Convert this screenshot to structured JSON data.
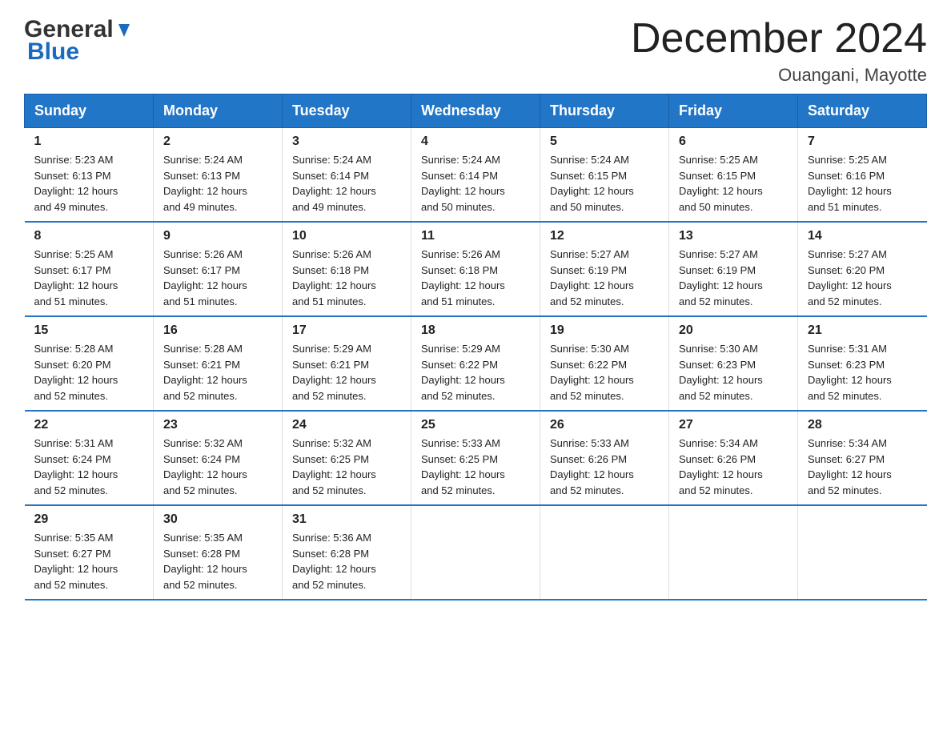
{
  "header": {
    "logo_general": "General",
    "logo_blue": "Blue",
    "month_title": "December 2024",
    "location": "Ouangani, Mayotte"
  },
  "days_of_week": [
    "Sunday",
    "Monday",
    "Tuesday",
    "Wednesday",
    "Thursday",
    "Friday",
    "Saturday"
  ],
  "weeks": [
    [
      {
        "day": "1",
        "sunrise": "5:23 AM",
        "sunset": "6:13 PM",
        "daylight": "12 hours and 49 minutes."
      },
      {
        "day": "2",
        "sunrise": "5:24 AM",
        "sunset": "6:13 PM",
        "daylight": "12 hours and 49 minutes."
      },
      {
        "day": "3",
        "sunrise": "5:24 AM",
        "sunset": "6:14 PM",
        "daylight": "12 hours and 49 minutes."
      },
      {
        "day": "4",
        "sunrise": "5:24 AM",
        "sunset": "6:14 PM",
        "daylight": "12 hours and 50 minutes."
      },
      {
        "day": "5",
        "sunrise": "5:24 AM",
        "sunset": "6:15 PM",
        "daylight": "12 hours and 50 minutes."
      },
      {
        "day": "6",
        "sunrise": "5:25 AM",
        "sunset": "6:15 PM",
        "daylight": "12 hours and 50 minutes."
      },
      {
        "day": "7",
        "sunrise": "5:25 AM",
        "sunset": "6:16 PM",
        "daylight": "12 hours and 51 minutes."
      }
    ],
    [
      {
        "day": "8",
        "sunrise": "5:25 AM",
        "sunset": "6:17 PM",
        "daylight": "12 hours and 51 minutes."
      },
      {
        "day": "9",
        "sunrise": "5:26 AM",
        "sunset": "6:17 PM",
        "daylight": "12 hours and 51 minutes."
      },
      {
        "day": "10",
        "sunrise": "5:26 AM",
        "sunset": "6:18 PM",
        "daylight": "12 hours and 51 minutes."
      },
      {
        "day": "11",
        "sunrise": "5:26 AM",
        "sunset": "6:18 PM",
        "daylight": "12 hours and 51 minutes."
      },
      {
        "day": "12",
        "sunrise": "5:27 AM",
        "sunset": "6:19 PM",
        "daylight": "12 hours and 52 minutes."
      },
      {
        "day": "13",
        "sunrise": "5:27 AM",
        "sunset": "6:19 PM",
        "daylight": "12 hours and 52 minutes."
      },
      {
        "day": "14",
        "sunrise": "5:27 AM",
        "sunset": "6:20 PM",
        "daylight": "12 hours and 52 minutes."
      }
    ],
    [
      {
        "day": "15",
        "sunrise": "5:28 AM",
        "sunset": "6:20 PM",
        "daylight": "12 hours and 52 minutes."
      },
      {
        "day": "16",
        "sunrise": "5:28 AM",
        "sunset": "6:21 PM",
        "daylight": "12 hours and 52 minutes."
      },
      {
        "day": "17",
        "sunrise": "5:29 AM",
        "sunset": "6:21 PM",
        "daylight": "12 hours and 52 minutes."
      },
      {
        "day": "18",
        "sunrise": "5:29 AM",
        "sunset": "6:22 PM",
        "daylight": "12 hours and 52 minutes."
      },
      {
        "day": "19",
        "sunrise": "5:30 AM",
        "sunset": "6:22 PM",
        "daylight": "12 hours and 52 minutes."
      },
      {
        "day": "20",
        "sunrise": "5:30 AM",
        "sunset": "6:23 PM",
        "daylight": "12 hours and 52 minutes."
      },
      {
        "day": "21",
        "sunrise": "5:31 AM",
        "sunset": "6:23 PM",
        "daylight": "12 hours and 52 minutes."
      }
    ],
    [
      {
        "day": "22",
        "sunrise": "5:31 AM",
        "sunset": "6:24 PM",
        "daylight": "12 hours and 52 minutes."
      },
      {
        "day": "23",
        "sunrise": "5:32 AM",
        "sunset": "6:24 PM",
        "daylight": "12 hours and 52 minutes."
      },
      {
        "day": "24",
        "sunrise": "5:32 AM",
        "sunset": "6:25 PM",
        "daylight": "12 hours and 52 minutes."
      },
      {
        "day": "25",
        "sunrise": "5:33 AM",
        "sunset": "6:25 PM",
        "daylight": "12 hours and 52 minutes."
      },
      {
        "day": "26",
        "sunrise": "5:33 AM",
        "sunset": "6:26 PM",
        "daylight": "12 hours and 52 minutes."
      },
      {
        "day": "27",
        "sunrise": "5:34 AM",
        "sunset": "6:26 PM",
        "daylight": "12 hours and 52 minutes."
      },
      {
        "day": "28",
        "sunrise": "5:34 AM",
        "sunset": "6:27 PM",
        "daylight": "12 hours and 52 minutes."
      }
    ],
    [
      {
        "day": "29",
        "sunrise": "5:35 AM",
        "sunset": "6:27 PM",
        "daylight": "12 hours and 52 minutes."
      },
      {
        "day": "30",
        "sunrise": "5:35 AM",
        "sunset": "6:28 PM",
        "daylight": "12 hours and 52 minutes."
      },
      {
        "day": "31",
        "sunrise": "5:36 AM",
        "sunset": "6:28 PM",
        "daylight": "12 hours and 52 minutes."
      },
      null,
      null,
      null,
      null
    ]
  ]
}
